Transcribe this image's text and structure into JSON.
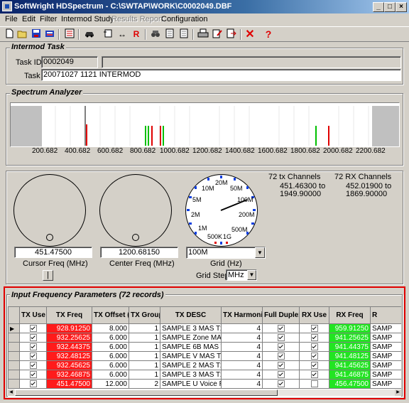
{
  "window": {
    "title": "SoftWright HDSpectrum - C:\\SWTAP\\WORK\\C0002049.DBF"
  },
  "menu": [
    {
      "label": "File",
      "enabled": true
    },
    {
      "label": "Edit",
      "enabled": true
    },
    {
      "label": "Filter",
      "enabled": true
    },
    {
      "label": "Intermod Study",
      "enabled": true
    },
    {
      "label": "Results Report",
      "enabled": false
    },
    {
      "label": "Configuration",
      "enabled": true
    }
  ],
  "toolbar_icons": [
    "new-icon",
    "open-icon",
    "save-icon",
    "print-setup-icon",
    "list-icon",
    "car-icon",
    "report-icon",
    "exchange-icon",
    "r-icon",
    "binoculars-icon",
    "page-icon",
    "page-icon-2",
    "printer-icon",
    "edit-page-icon",
    "export-icon",
    "delete-icon",
    "help-icon"
  ],
  "intermod_task": {
    "title": "Intermod Task",
    "task_id_label": "Task ID:",
    "task_id": "0002049",
    "task_label": "Task",
    "task": "20071027 1121 INTERMOD"
  },
  "spectrum": {
    "title": "Spectrum Analyzer",
    "ticks": [
      "200.682",
      "400.682",
      "600.682",
      "800.682",
      "1000.682",
      "1200.682",
      "1400.682",
      "1600.682",
      "1800.682",
      "2000.682",
      "2200.682"
    ],
    "colors": {
      "rx": "#00c000",
      "tx": "#e00000",
      "marker": "#000000"
    }
  },
  "controls": {
    "cursor_freq_value": "451.47500",
    "cursor_freq_label": "Cursor Freq (MHz)",
    "center_freq_value": "1200.68150",
    "center_freq_label": "Center Freq (MHz)",
    "grid_value": "100M",
    "grid_label": "Grid (Hz)",
    "grid_step_label": "Grid Step",
    "grid_step_value": "MHz",
    "grid_dial_labels": [
      "10M",
      "20M",
      "50M",
      "100M",
      "200M",
      "500M",
      "1G",
      "500K",
      "1M",
      "2M",
      "5M"
    ],
    "tx_channels": "72 tx Channels",
    "tx_range_1": "451.46300 to",
    "tx_range_2": "1949.90000",
    "rx_channels": "72 RX Channels",
    "rx_range_1": "452.01900 to",
    "rx_range_2": "1869.90000"
  },
  "params": {
    "title": "Input Frequency Parameters (72 records)",
    "headers": [
      "TX Use",
      "TX Freq",
      "TX Offset (KHz)",
      "TX Group",
      "TX DESC",
      "TX Harmonics",
      "Full Duplex",
      "RX Use",
      "RX Freq",
      "R"
    ],
    "rows": [
      {
        "tx_use": true,
        "tx_freq": "928.91250",
        "offset": "8.000",
        "group": "1",
        "desc": "SAMPLE 3 MAS Tx",
        "harm": "4",
        "duplex": true,
        "rx_use": true,
        "rx_freq": "959.91250",
        "r": "SAMP",
        "current": true
      },
      {
        "tx_use": true,
        "tx_freq": "932.25625",
        "offset": "6.000",
        "group": "1",
        "desc": "SAMPLE Zone MAS",
        "harm": "4",
        "duplex": true,
        "rx_use": true,
        "rx_freq": "941.25625",
        "r": "SAMP",
        "current": false
      },
      {
        "tx_use": true,
        "tx_freq": "932.44375",
        "offset": "6.000",
        "group": "1",
        "desc": "SAMPLE 6B MAS Tx",
        "harm": "4",
        "duplex": true,
        "rx_use": true,
        "rx_freq": "941.44375",
        "r": "SAMP",
        "current": false
      },
      {
        "tx_use": true,
        "tx_freq": "932.48125",
        "offset": "6.000",
        "group": "1",
        "desc": "SAMPLE V MAS Tx",
        "harm": "4",
        "duplex": true,
        "rx_use": true,
        "rx_freq": "941.48125",
        "r": "SAMP",
        "current": false
      },
      {
        "tx_use": true,
        "tx_freq": "932.45625",
        "offset": "6.000",
        "group": "1",
        "desc": "SAMPLE 2 MAS Tx",
        "harm": "4",
        "duplex": true,
        "rx_use": true,
        "rx_freq": "941.45625",
        "r": "SAMP",
        "current": false
      },
      {
        "tx_use": true,
        "tx_freq": "932.46875",
        "offset": "6.000",
        "group": "1",
        "desc": "SAMPLE 3  MAS Tx",
        "harm": "4",
        "duplex": true,
        "rx_use": true,
        "rx_freq": "941.46875",
        "r": "SAMP",
        "current": false
      },
      {
        "tx_use": true,
        "tx_freq": "451.47500",
        "offset": "12.000",
        "group": "2",
        "desc": "SAMPLE U  Voice R",
        "harm": "4",
        "duplex": true,
        "rx_use": false,
        "rx_freq": "456.47500",
        "r": "SAMP",
        "current": false
      }
    ]
  }
}
